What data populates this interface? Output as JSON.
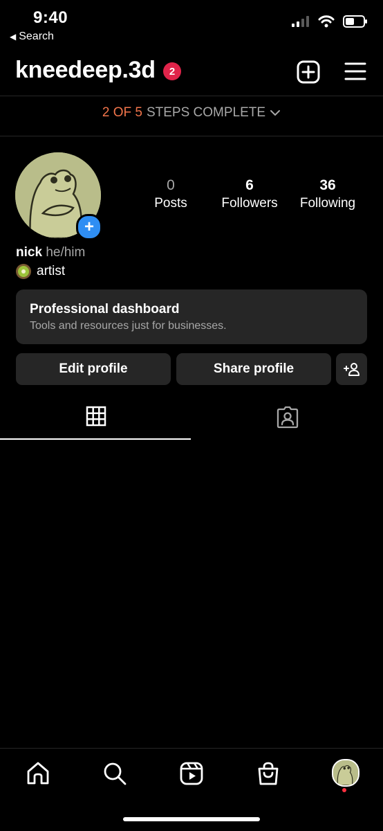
{
  "status_bar": {
    "time": "9:40",
    "back_label": "Search",
    "icons": [
      "signal-icon",
      "wifi-icon",
      "battery-icon"
    ]
  },
  "header": {
    "username": "kneedeep.3d",
    "notification_count": "2",
    "icons": [
      "create-post-icon",
      "menu-icon"
    ]
  },
  "steps": {
    "count": "2 OF 5",
    "label": "STEPS COMPLETE"
  },
  "profile": {
    "stats": [
      {
        "value": "0",
        "label": "Posts"
      },
      {
        "value": "6",
        "label": "Followers"
      },
      {
        "value": "36",
        "label": "Following"
      }
    ],
    "name": "nick",
    "pronouns": "he/him",
    "bio": "artist",
    "bio_emoji": "kiwi-emoji"
  },
  "dashboard": {
    "title": "Professional dashboard",
    "subtitle": "Tools and resources just for businesses."
  },
  "actions": {
    "edit": "Edit profile",
    "share": "Share profile"
  },
  "tabs": [
    "grid-icon",
    "tagged-icon"
  ],
  "bottom_nav": [
    "home-icon",
    "search-icon",
    "reels-icon",
    "shop-icon",
    "profile-avatar"
  ],
  "colors": {
    "background": "#000000",
    "surface": "#262626",
    "accent_orange": "#f2754b",
    "badge_red": "#e0244a",
    "add_blue": "#2f8ef3",
    "muted_text": "#a8a8a8"
  }
}
